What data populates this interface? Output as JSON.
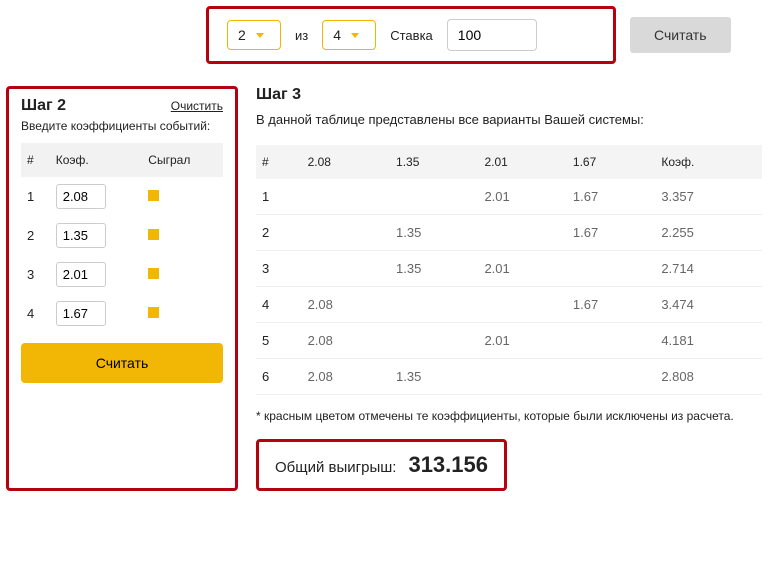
{
  "top": {
    "pick": "2",
    "of_label": "из",
    "total": "4",
    "stake_label": "Ставка",
    "stake_value": "100",
    "calc_button": "Считать"
  },
  "step2": {
    "title": "Шаг 2",
    "clear": "Очистить",
    "subtitle": "Введите коэффициенты событий:",
    "headers": {
      "num": "#",
      "coef": "Коэф.",
      "played": "Сыграл"
    },
    "rows": [
      {
        "n": "1",
        "coef": "2.08"
      },
      {
        "n": "2",
        "coef": "1.35"
      },
      {
        "n": "3",
        "coef": "2.01"
      },
      {
        "n": "4",
        "coef": "1.67"
      }
    ],
    "calc_button": "Считать"
  },
  "step3": {
    "title": "Шаг 3",
    "subtitle": "В данной таблице представлены все варианты Вашей системы:",
    "headers": {
      "num": "#",
      "c1": "2.08",
      "c2": "1.35",
      "c3": "2.01",
      "c4": "1.67",
      "coef": "Коэф."
    },
    "rows": [
      {
        "n": "1",
        "v1": "",
        "v2": "",
        "v3": "2.01",
        "v4": "1.67",
        "coef": "3.357"
      },
      {
        "n": "2",
        "v1": "",
        "v2": "1.35",
        "v3": "",
        "v4": "1.67",
        "coef": "2.255"
      },
      {
        "n": "3",
        "v1": "",
        "v2": "1.35",
        "v3": "2.01",
        "v4": "",
        "coef": "2.714"
      },
      {
        "n": "4",
        "v1": "2.08",
        "v2": "",
        "v3": "",
        "v4": "1.67",
        "coef": "3.474"
      },
      {
        "n": "5",
        "v1": "2.08",
        "v2": "",
        "v3": "2.01",
        "v4": "",
        "coef": "4.181"
      },
      {
        "n": "6",
        "v1": "2.08",
        "v2": "1.35",
        "v3": "",
        "v4": "",
        "coef": "2.808"
      }
    ],
    "note": "* красным цветом отмечены те коэффициенты, которые были исключены из расчета.",
    "total_label": "Общий выигрыш:",
    "total_value": "313.156"
  }
}
